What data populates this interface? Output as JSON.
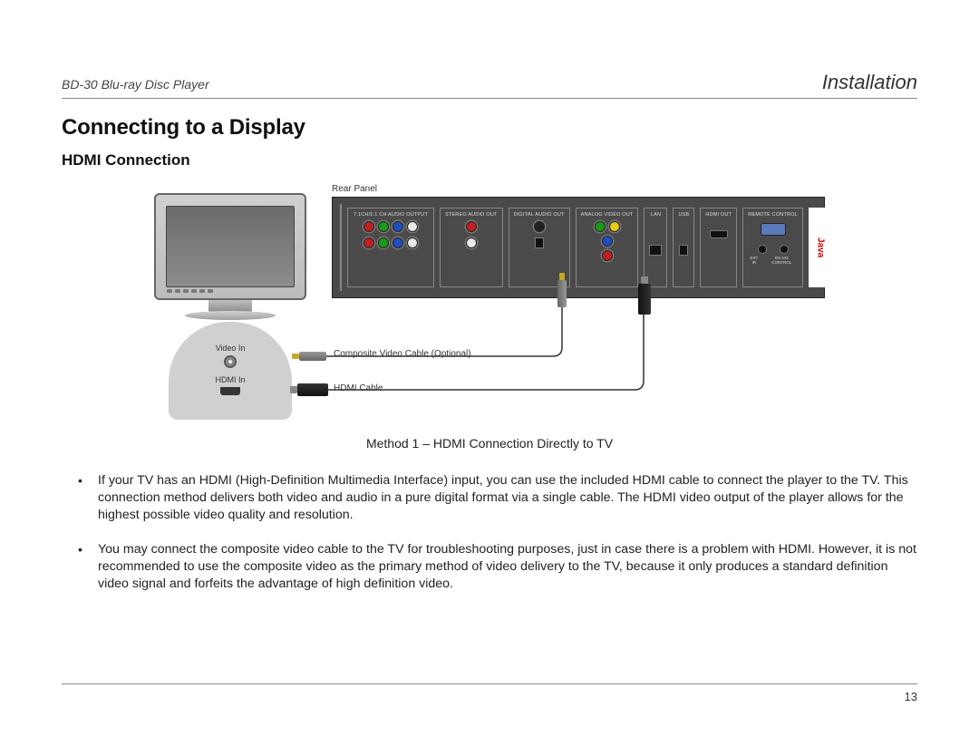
{
  "header": {
    "left": "BD-30 Blu-ray Disc Player",
    "right": "Installation"
  },
  "heading": "Connecting to a Display",
  "subheading": "HDMI Connection",
  "diagram": {
    "rear_panel_label": "Rear Panel",
    "tv_ports": {
      "video_in": "Video In",
      "hdmi_in": "HDMI In"
    },
    "cable_labels": {
      "composite": "Composite Video Cable (Optional)",
      "hdmi": "HDMI Cable"
    },
    "panel_groups": {
      "audio71": "7.1CH/5.1 CH AUDIO OUTPUT",
      "stereo": "STEREO AUDIO OUT",
      "digital_audio": "DIGITAL AUDIO OUT",
      "analog_video": "ANALOG VIDEO OUT",
      "lan": "LAN",
      "usb": "USB",
      "hdmi_out": "HDMI OUT",
      "remote": "REMOTE CONTROL",
      "ext_ir": "EXT IR",
      "rs232": "RS-232 CONTROL"
    },
    "java_badge": "Java"
  },
  "caption": "Method 1 – HDMI Connection Directly to TV",
  "bullets": [
    "If your TV has an HDMI (High-Definition Multimedia Interface) input, you can use the included HDMI cable to connect the player to the TV. This connection method delivers both video and audio in a pure digital format via a single cable. The HDMI video output of the player allows for the highest possible video quality and resolution.",
    "You may connect the composite video cable to the TV for troubleshooting purposes, just in case there is a problem with HDMI. However, it is not recommended to use the composite video as the primary method of video delivery to the TV, because it only produces a standard definition video signal and forfeits the advantage of high definition video."
  ],
  "page_number": "13"
}
